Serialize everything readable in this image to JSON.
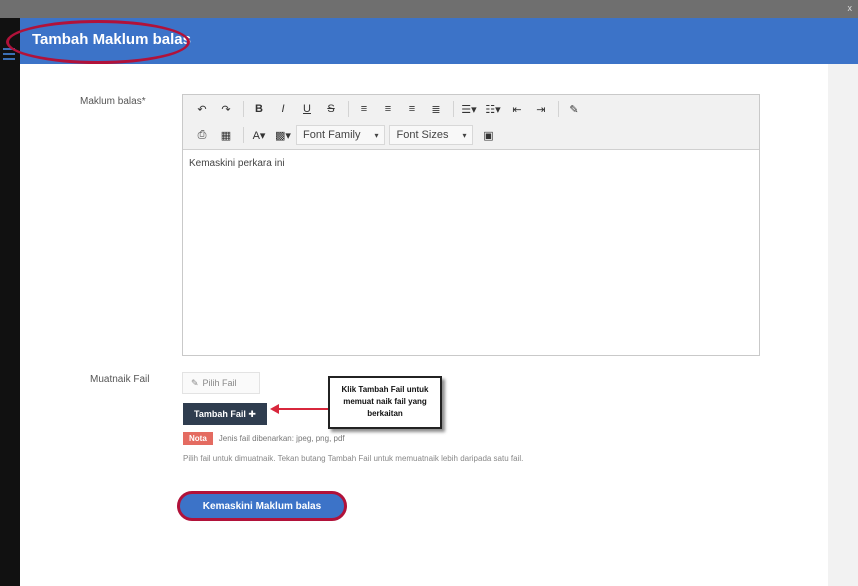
{
  "window": {
    "close_label": "x"
  },
  "modal": {
    "title": "Tambah Maklum balas",
    "highlight_color": "#b1123a",
    "header_color": "#3c73c8"
  },
  "form": {
    "feedback_label": "Maklum balas*",
    "attachment_label": "Muatnaik Fail",
    "editor_content": "Kemaskini perkara ini",
    "toolbar": {
      "row1": [
        "undo-icon",
        "redo-icon",
        "bold-icon",
        "italic-icon",
        "underline-icon",
        "strikethrough-icon",
        "align-left-icon",
        "align-center-icon",
        "align-right-icon",
        "align-justify-icon",
        "bullet-list-icon",
        "numbered-list-icon",
        "outdent-icon",
        "indent-icon",
        "eraser-icon"
      ],
      "row2": [
        "print-icon",
        "table-icon",
        "font-color-icon",
        "highlight-icon",
        "image-icon"
      ],
      "font_family_label": "Font Family",
      "font_sizes_label": "Font Sizes"
    },
    "file_placeholder": "Pilih Fail",
    "add_file_button": "Tambah Fail ✚",
    "badge_label": "Nota",
    "note_text": "Jenis fail dibenarkan: jpeg, png, pdf",
    "help_text": "Pilih fail untuk dimuatnaik. Tekan butang Tambah Fail untuk memuatnaik lebih daripada satu fail.",
    "submit_button": "Kemaskini Maklum balas"
  },
  "callout": {
    "text": "Klik Tambah Fail untuk memuat naik fail yang berkaitan"
  }
}
